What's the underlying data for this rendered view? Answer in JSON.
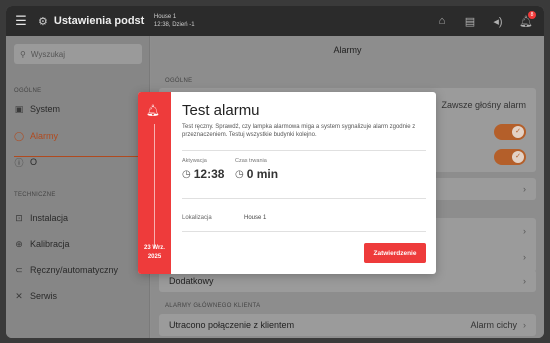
{
  "topbar": {
    "menu_icon": "hamburger-icon",
    "title": "Ustawienia podst",
    "house_name": "House 1",
    "house_time": "12:38, Dzień -1",
    "badge_count": "8"
  },
  "sidebar": {
    "search_placeholder": "Wyszukaj",
    "section_general": "OGÓLNE",
    "section_technical": "TECHNICZNE",
    "items": [
      {
        "label": "System",
        "icon": "monitor-icon"
      },
      {
        "label": "Alarmy",
        "icon": "bell-icon",
        "active": true
      },
      {
        "label": "O",
        "icon": "info-icon"
      },
      {
        "label": "Instalacja",
        "icon": "install-icon"
      },
      {
        "label": "Kalibracja",
        "icon": "calibration-icon"
      },
      {
        "label": "Ręczny/automatyczny",
        "icon": "toggle-mode-icon"
      },
      {
        "label": "Serwis",
        "icon": "wrench-icon"
      }
    ]
  },
  "main": {
    "title": "Alarmy",
    "section_general": "OGÓLNE",
    "always_loud": "Zawsze głośny alarm",
    "extra": "Dodatkowy",
    "section_client": "ALARMY GŁÓWNEGO KLIENTA",
    "client_row_label": "Utracono połączenie z klientem",
    "client_row_value": "Alarm cichy"
  },
  "modal": {
    "title": "Test alarmu",
    "description": "Test ręczny. Sprawdź, czy lampka alarmowa miga a system sygnalizuje alarm zgodnie z przeznaczeniem. Testuj wszystkie budynki kolejno.",
    "activation_label": "Aktywacja",
    "activation_value": "12:38",
    "duration_label": "Czas trwania",
    "duration_value": "0 min",
    "location_label": "Lokalizacja",
    "location_value": "House 1",
    "date_line1": "23 Wrz.",
    "date_line2": "2025",
    "confirm_label": "Zatwierdzenie"
  },
  "colors": {
    "alarm_red": "#ee3b3b",
    "accent_orange": "#b45f2a",
    "topbar": "#2b2b2b"
  }
}
